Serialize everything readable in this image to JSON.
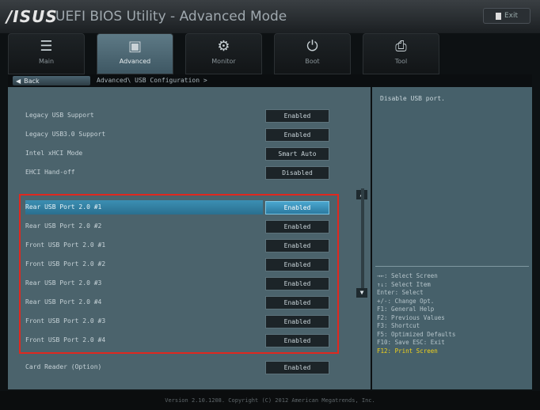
{
  "header": {
    "brand": "/ISUS",
    "title": "UEFI BIOS Utility - Advanced Mode",
    "exit_label": "Exit"
  },
  "tabs": [
    {
      "label": "Main",
      "icon": "list-icon"
    },
    {
      "label": "Advanced",
      "icon": "advanced-icon"
    },
    {
      "label": "Monitor",
      "icon": "monitor-icon"
    },
    {
      "label": "Boot",
      "icon": "power-icon"
    },
    {
      "label": "Tool",
      "icon": "printer-icon"
    }
  ],
  "breadcrumb": {
    "back_label": "Back",
    "path": "Advanced\\ USB Configuration >"
  },
  "settings": [
    {
      "label": "Legacy USB Support",
      "value": "Enabled"
    },
    {
      "label": "Legacy USB3.0 Support",
      "value": "Enabled"
    },
    {
      "label": "Intel xHCI Mode",
      "value": "Smart Auto"
    },
    {
      "label": "EHCI Hand-off",
      "value": "Disabled"
    },
    {
      "label": "Rear  USB Port 2.0 #1",
      "value": "Enabled"
    },
    {
      "label": "Rear  USB Port 2.0 #2",
      "value": "Enabled"
    },
    {
      "label": "Front USB Port 2.0 #1",
      "value": "Enabled"
    },
    {
      "label": "Front USB Port 2.0 #2",
      "value": "Enabled"
    },
    {
      "label": "Rear  USB Port 2.0 #3",
      "value": "Enabled"
    },
    {
      "label": "Rear  USB Port 2.0 #4",
      "value": "Enabled"
    },
    {
      "label": "Front USB Port 2.0 #3",
      "value": "Enabled"
    },
    {
      "label": "Front USB Port 2.0 #4",
      "value": "Enabled"
    },
    {
      "label": "Card  Reader (Option)",
      "value": "Enabled"
    }
  ],
  "help": {
    "description": "Disable USB port.",
    "keys": [
      "→←: Select Screen",
      "↑↓: Select Item",
      "Enter: Select",
      "+/-: Change Opt.",
      "F1: General Help",
      "F2: Previous Values",
      "F3: Shortcut",
      "F5: Optimized Defaults",
      "F10: Save  ESC: Exit",
      "F12: Print Screen"
    ]
  },
  "footer": "Version 2.10.1208. Copyright (C) 2012 American Megatrends, Inc.",
  "colors": {
    "highlight_box": "#e0281f",
    "selected_row": "#3c8fb3",
    "key_highlight": "#f2d21a"
  }
}
